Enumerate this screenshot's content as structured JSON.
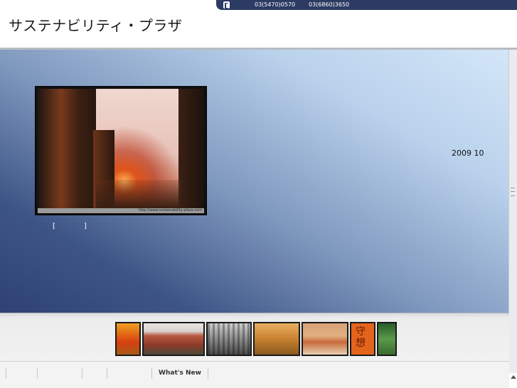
{
  "contact": {
    "phone_icon": "phone-icon",
    "phone_1": "03(5470)0570",
    "phone_2": "03(6860)3650",
    "bar_color": "#2b3b63"
  },
  "header": {
    "title": "サステナビリティ・プラザ"
  },
  "hero": {
    "photo_caption": "http://www.sustainability-plaza.com",
    "more_link_open": "[",
    "more_link_close": "]",
    "date": "2009 10",
    "gradient_light": "#d4e6f8",
    "gradient_dark": "#2e4273"
  },
  "thumbnails": {
    "items": [
      "tower",
      "brick-building",
      "cathedral-interior",
      "statue",
      "reclining-figure",
      "calligraphy",
      "garden"
    ],
    "calligraphy_text": "守 想"
  },
  "footer_nav": {
    "items": [
      "",
      "",
      "",
      "",
      "What's New"
    ]
  }
}
